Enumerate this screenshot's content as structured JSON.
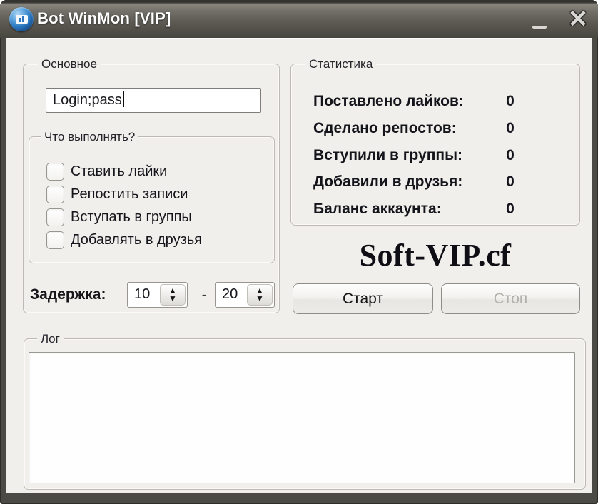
{
  "window": {
    "title": "Bot WinMon [VIP]",
    "close_glyph": "✕"
  },
  "left_panel": {
    "group_label": "Основное",
    "login_input": {
      "value": "Login;pass"
    },
    "tasks_group": {
      "label": "Что выполнять?",
      "checkboxes": [
        {
          "label": "Ставить лайки",
          "checked": false
        },
        {
          "label": "Репостить записи",
          "checked": false
        },
        {
          "label": "Вступать в группы",
          "checked": false
        },
        {
          "label": "Добавлять в друзья",
          "checked": false
        }
      ]
    },
    "delay": {
      "label": "Задержка:",
      "from_value": "10",
      "separator": "-",
      "to_value": "20",
      "spin_up_glyph": "▲",
      "spin_down_glyph": "▼"
    }
  },
  "right_panel": {
    "group_label": "Статистика",
    "rows": [
      {
        "label": "Поставлено лайков:",
        "value": "0"
      },
      {
        "label": "Сделано репостов:",
        "value": "0"
      },
      {
        "label": "Вступили в группы:",
        "value": "0"
      },
      {
        "label": "Добавили в друзья:",
        "value": "0"
      },
      {
        "label": "Баланс аккаунта:",
        "value": "0"
      }
    ],
    "watermark": "Soft-VIP.cf",
    "start_button": "Старт",
    "stop_button": "Стоп"
  },
  "log_panel": {
    "group_label": "Лог",
    "content": ""
  },
  "colors": {
    "titlebar": "#5b5953",
    "frame": "#4b4a45",
    "client_bg": "#f1efeb",
    "group_border": "#bdbab4",
    "icon_blue": "#2a77c0",
    "disabled_text": "#b2b0ac"
  }
}
